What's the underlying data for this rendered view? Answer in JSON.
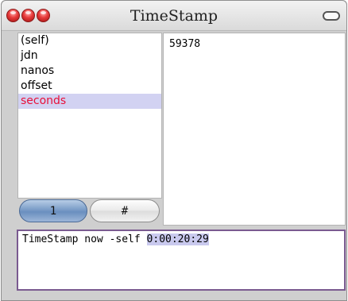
{
  "window": {
    "title": "TimeStamp"
  },
  "fields": {
    "items": [
      "(self)",
      "jdn",
      "nanos",
      "offset",
      "seconds"
    ],
    "selected_index": 4
  },
  "value_pane": {
    "text": "59378"
  },
  "buttons": {
    "primary_label": "1",
    "secondary_label": "#"
  },
  "code_pane": {
    "expression": "TimeStamp now -self ",
    "result": "0:00:20:29"
  },
  "colors": {
    "selection_bg": "#d2d2f2",
    "selection_text": "#e8103a",
    "code_border": "#7a5a90"
  }
}
